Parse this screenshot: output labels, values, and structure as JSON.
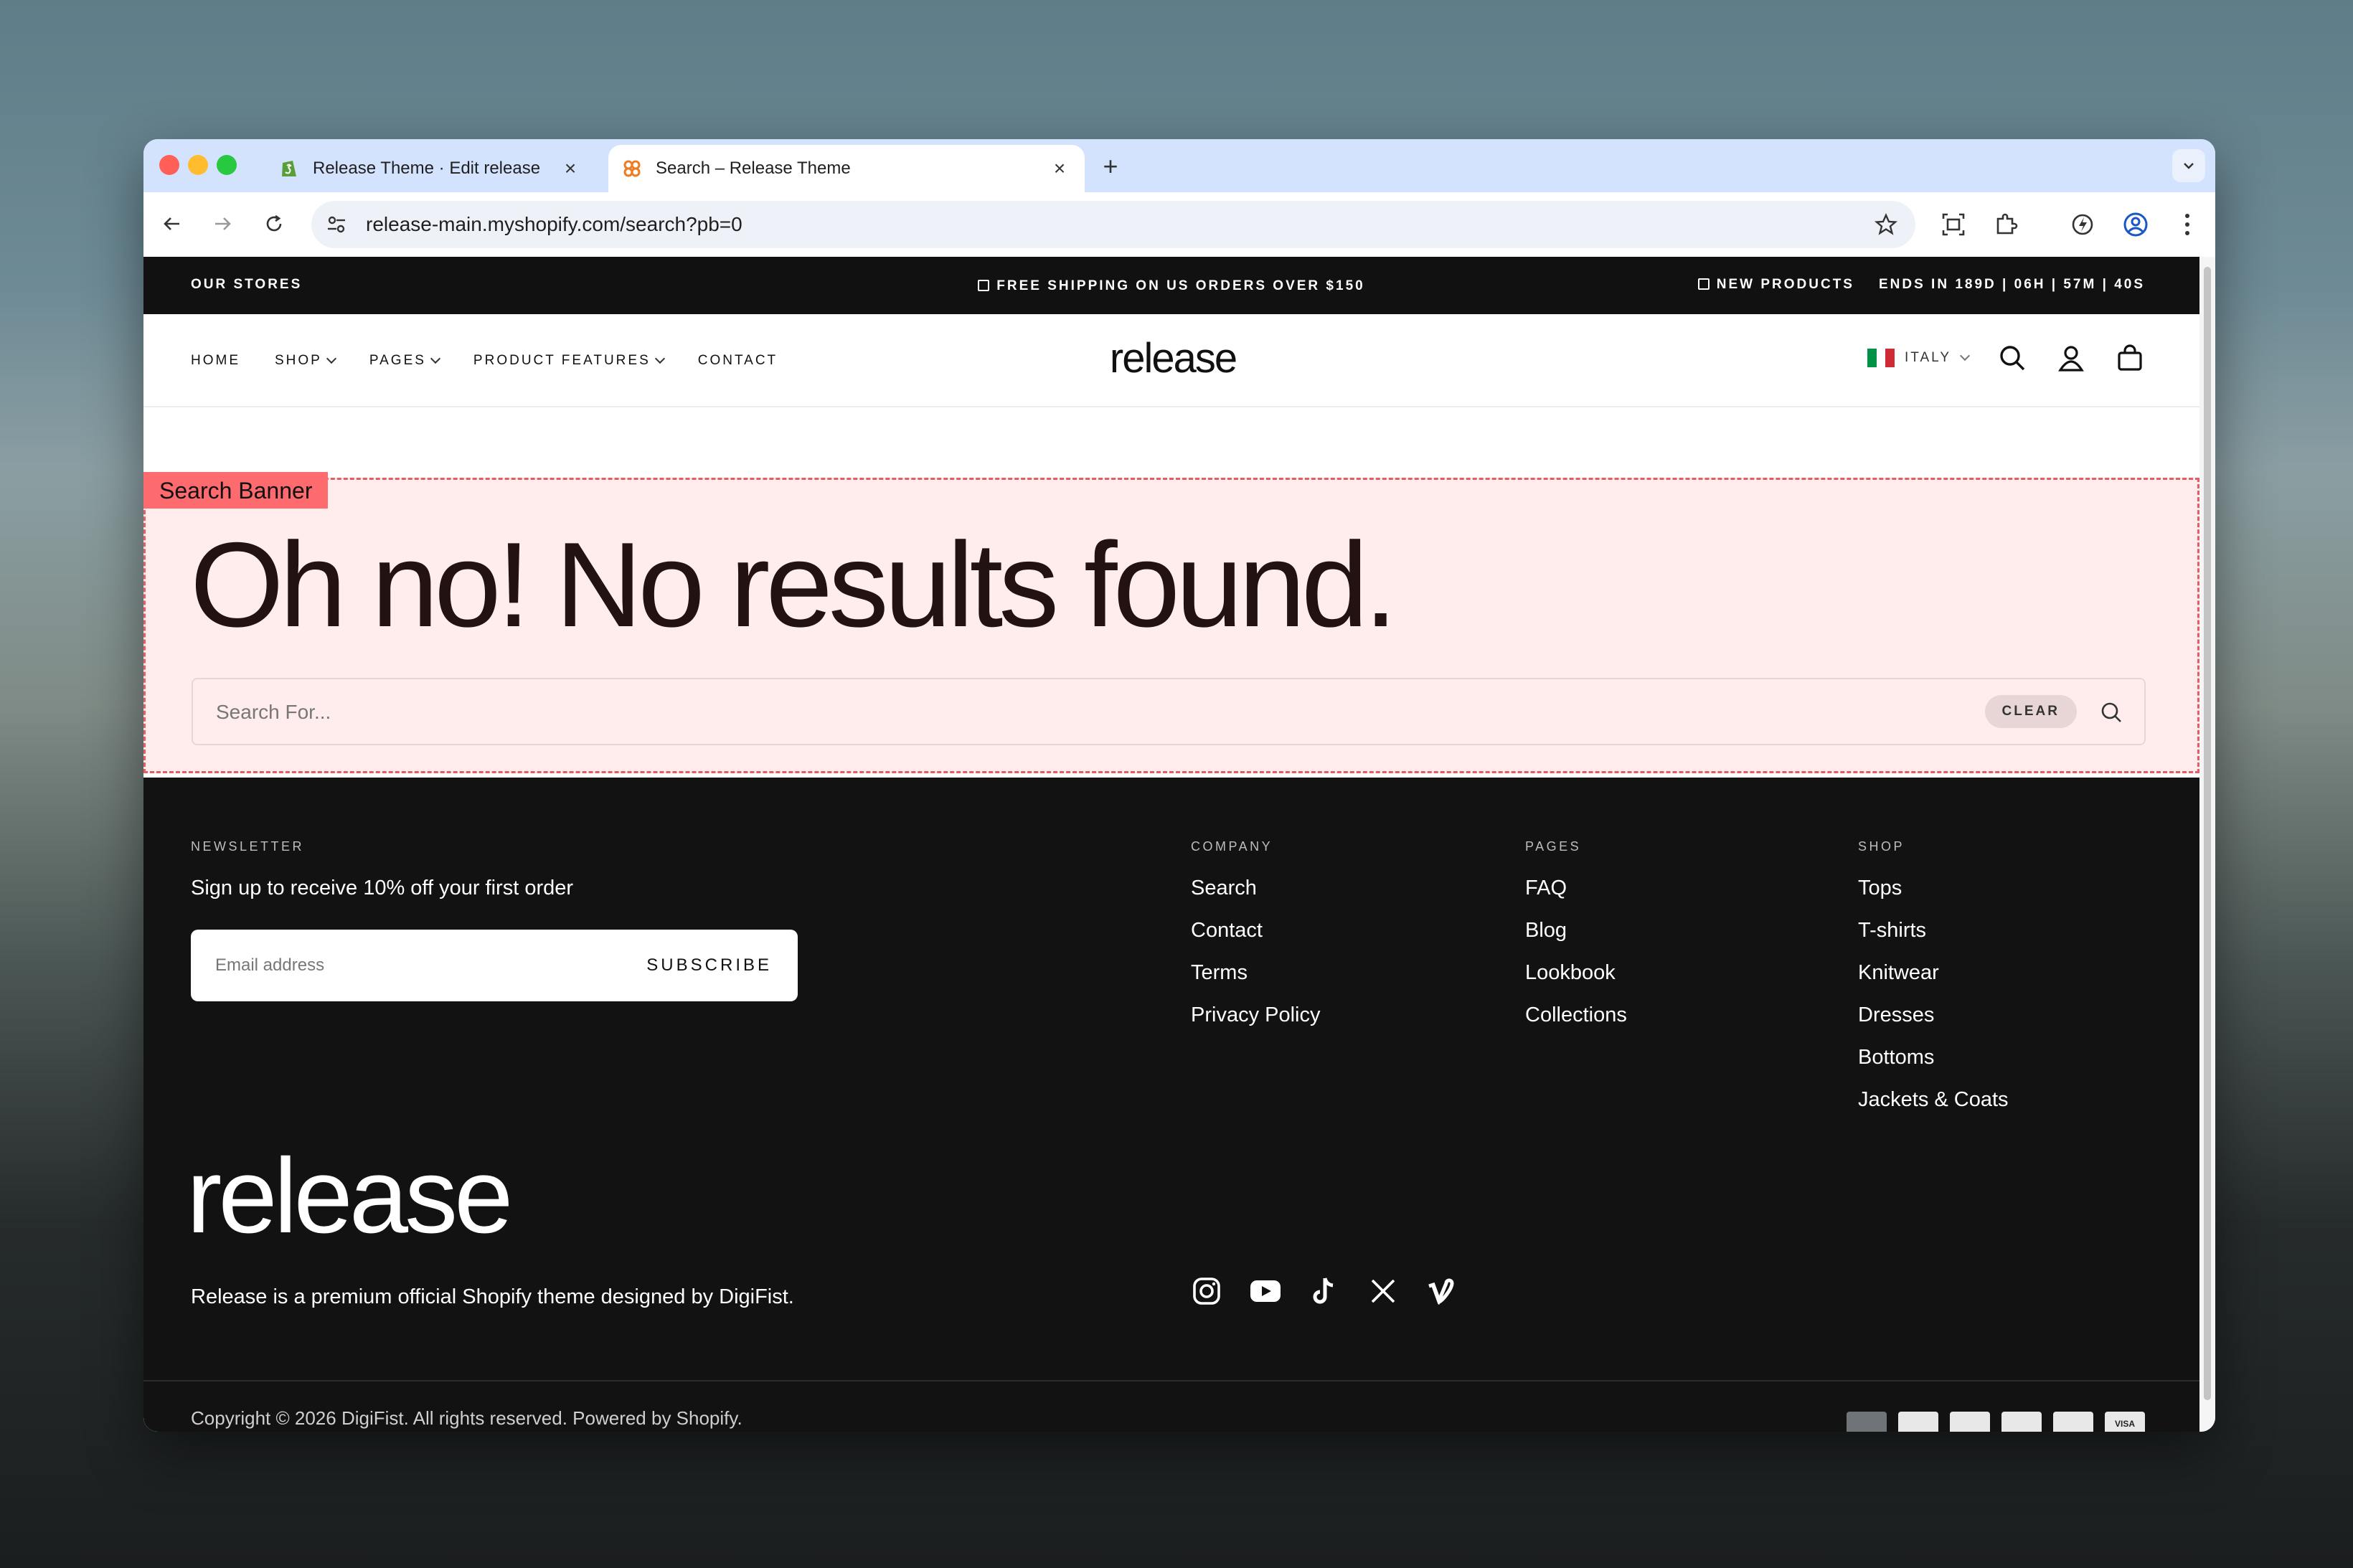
{
  "browser": {
    "tabs": [
      {
        "title": "Release Theme · Edit release"
      },
      {
        "title": "Search – Release Theme"
      }
    ],
    "new_tab": "+",
    "url": "release-main.myshopify.com/search?pb=0"
  },
  "announcement": {
    "left": "OUR STORES",
    "center": "FREE SHIPPING ON US ORDERS OVER $150",
    "right_label": "NEW PRODUCTS",
    "countdown": "ENDS IN 189D | 06H | 57M | 40S"
  },
  "header": {
    "nav": [
      {
        "label": "HOME"
      },
      {
        "label": "SHOP"
      },
      {
        "label": "PAGES"
      },
      {
        "label": "PRODUCT FEATURES"
      },
      {
        "label": "CONTACT"
      }
    ],
    "logo": "release",
    "country": "ITALY"
  },
  "banner": {
    "annotation": "Search Banner",
    "heading": "Oh no! No results found.",
    "search_placeholder": "Search For...",
    "clear_label": "CLEAR"
  },
  "footer": {
    "newsletter_heading": "NEWSLETTER",
    "newsletter_text": "Sign up to receive 10% off your first order",
    "email_placeholder": "Email address",
    "subscribe_label": "SUBSCRIBE",
    "columns": [
      {
        "heading": "COMPANY",
        "links": [
          "Search",
          "Contact",
          "Terms",
          "Privacy Policy"
        ]
      },
      {
        "heading": "PAGES",
        "links": [
          "FAQ",
          "Blog",
          "Lookbook",
          "Collections"
        ]
      },
      {
        "heading": "SHOP",
        "links": [
          "Tops",
          "T-shirts",
          "Knitwear",
          "Dresses",
          "Bottoms",
          "Jackets & Coats"
        ]
      }
    ],
    "logo": "release",
    "tagline": "Release is a premium official Shopify theme designed by DigiFist.",
    "social_icons": [
      "instagram-icon",
      "youtube-icon",
      "tiktok-icon",
      "x-icon",
      "vimeo-icon"
    ],
    "copyright": "Copyright © 2026 DigiFist. All rights reserved. Powered by Shopify.",
    "payment_icons": [
      "amex-icon",
      "diners-icon",
      "discover-icon",
      "mastercard-icon",
      "paypal-icon",
      "visa-icon"
    ],
    "visa_label": "VISA"
  },
  "colors": {
    "banner_bg": "#ffeced",
    "banner_border": "#e45c64",
    "annotation_bg": "#fd6b6e",
    "footer_bg": "#121212",
    "announcement_bg": "#111111",
    "tab_strip": "#d3e3fd"
  }
}
